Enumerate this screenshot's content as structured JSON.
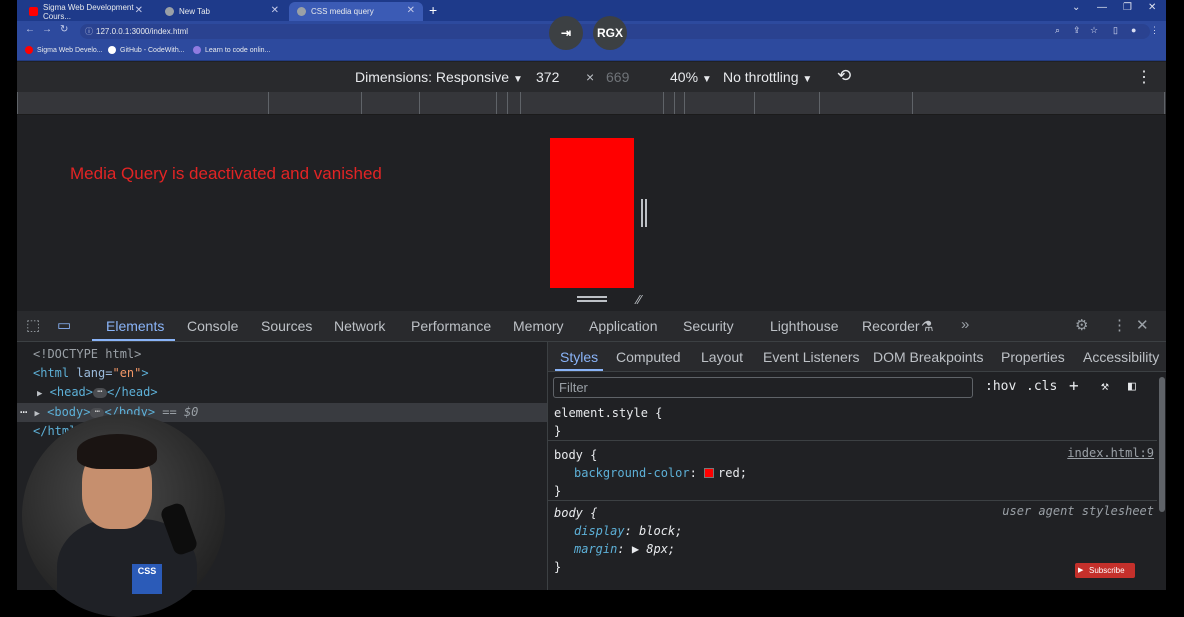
{
  "browser": {
    "tabs": [
      {
        "title": "Sigma Web Development Cours...",
        "icon_color": "#ff0000"
      },
      {
        "title": "New Tab",
        "icon_color": "#9aa0a6"
      },
      {
        "title": "CSS media query",
        "icon_color": "#9aa0a6"
      }
    ],
    "url": "127.0.0.1:3000/index.html",
    "bookmarks": [
      {
        "label": "Sigma Web Develo...",
        "icon_color": "#ff0000"
      },
      {
        "label": "GitHub - CodeWith...",
        "icon_color": "#ffffff"
      },
      {
        "label": "Learn to code onlin...",
        "icon_color": "#8f7be0"
      }
    ],
    "overlay_label": "RGX"
  },
  "device_toolbar": {
    "dimensions": "Dimensions: Responsive",
    "width": "372",
    "times": "×",
    "height": "669",
    "zoom": "40%",
    "throttling": "No throttling"
  },
  "viewport": {
    "message": "Media Query is deactivated and vanished",
    "message_color": "#e22424",
    "page_background": "#ff0000"
  },
  "devtools": {
    "tabs": [
      "Elements",
      "Console",
      "Sources",
      "Network",
      "Performance",
      "Memory",
      "Application",
      "Security",
      "Lighthouse",
      "Recorder"
    ],
    "active_tab": "Elements",
    "dom": {
      "doctype": "<!DOCTYPE html>",
      "html_open": "<html",
      "lang_attr": " lang=",
      "lang_val": "\"en\"",
      "html_close_gt": ">",
      "head_open": "<head>",
      "head_close": "</head>",
      "body_open": "<body>",
      "body_close": "</body>",
      "body_suffix": " == $0",
      "html_end": "</html>",
      "ellipsis": "⋯",
      "dots": "⋯"
    },
    "styles_tabs": [
      "Styles",
      "Computed",
      "Layout",
      "Event Listeners",
      "DOM Breakpoints",
      "Properties",
      "Accessibility"
    ],
    "filter_placeholder": "Filter",
    "hov": ":hov",
    "cls": ".cls",
    "rules": {
      "element_style_open": "element.style {",
      "close_brace": "}",
      "body_open": "body {",
      "bg_prop": "background-color",
      "colon": ": ",
      "bg_val": "red;",
      "source": "index.html:9",
      "ua_label": "user agent stylesheet",
      "display_prop": "display",
      "display_val": "block;",
      "margin_prop": "margin",
      "margin_val": "▶ 8px;"
    }
  },
  "subscribe": "Subscribe",
  "webcam_logo": "CSS"
}
